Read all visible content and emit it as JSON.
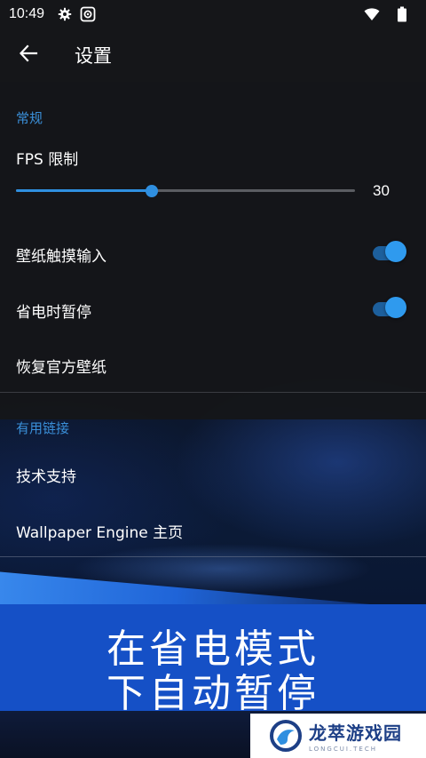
{
  "status_bar": {
    "time": "10:49",
    "left_icons": [
      "gear-icon",
      "camera-settings-icon"
    ],
    "right_icons": [
      "wifi-icon",
      "battery-icon"
    ]
  },
  "toolbar": {
    "back_icon": "arrow-left-icon",
    "title": "设置"
  },
  "general": {
    "section_title": "常规",
    "fps_label": "FPS 限制",
    "fps_value": "30",
    "fps_slider_fraction": 0.4,
    "touch_input_label": "壁纸触摸输入",
    "touch_input_on": true,
    "power_save_label": "省电时暂停",
    "power_save_on": true,
    "restore_label": "恢复官方壁纸"
  },
  "links": {
    "section_title": "有用链接",
    "support_label": "技术支持",
    "homepage_label": "Wallpaper Engine 主页"
  },
  "banner": {
    "line1": "在省电模式",
    "line2": "下自动暂停"
  },
  "watermark": {
    "name_cn": "龙萃游戏园",
    "name_en": "LONGCUI.TECH"
  },
  "colors": {
    "accent": "#2f8fe0",
    "section_label": "#3a8fd8",
    "banner": "#1550c6",
    "panel": "#151619"
  }
}
